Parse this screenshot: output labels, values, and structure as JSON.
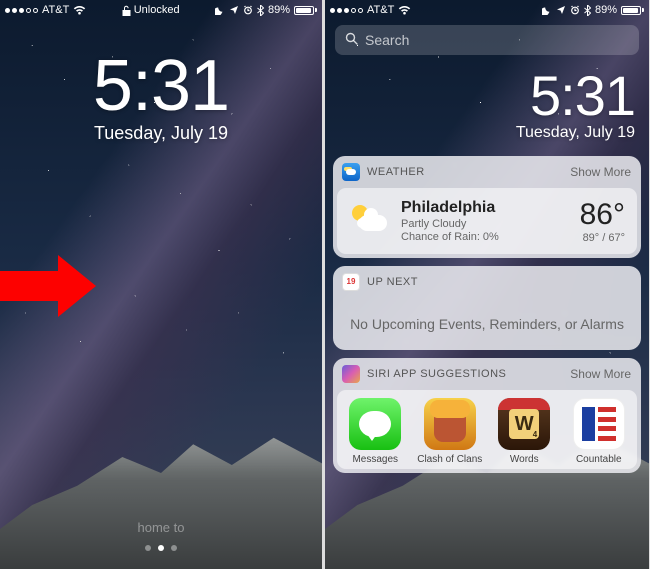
{
  "left": {
    "status": {
      "carrier": "AT&T",
      "lock_label": "Unlocked",
      "battery_pct": "89%"
    },
    "clock": {
      "time": "5:31",
      "date": "Tuesday, July 19"
    },
    "slide_hint": "home to"
  },
  "right": {
    "status": {
      "carrier": "AT&T",
      "battery_pct": "89%"
    },
    "search_placeholder": "Search",
    "clock": {
      "time": "5:31",
      "date": "Tuesday, July 19"
    },
    "widgets": {
      "weather": {
        "title": "WEATHER",
        "show_more": "Show More",
        "city": "Philadelphia",
        "condition": "Partly Cloudy",
        "rain": "Chance of Rain: 0%",
        "temp": "86°",
        "range": "89° / 67°"
      },
      "upnext": {
        "title": "UP NEXT",
        "cal_day": "19",
        "message": "No Upcoming Events, Reminders, or Alarms"
      },
      "siri": {
        "title": "SIRI APP SUGGESTIONS",
        "show_more": "Show More",
        "apps": {
          "messages": "Messages",
          "clash": "Clash of Clans",
          "words": "Words",
          "words_tile": "W",
          "words_tile_pts": "4",
          "countable": "Countable"
        }
      }
    }
  }
}
